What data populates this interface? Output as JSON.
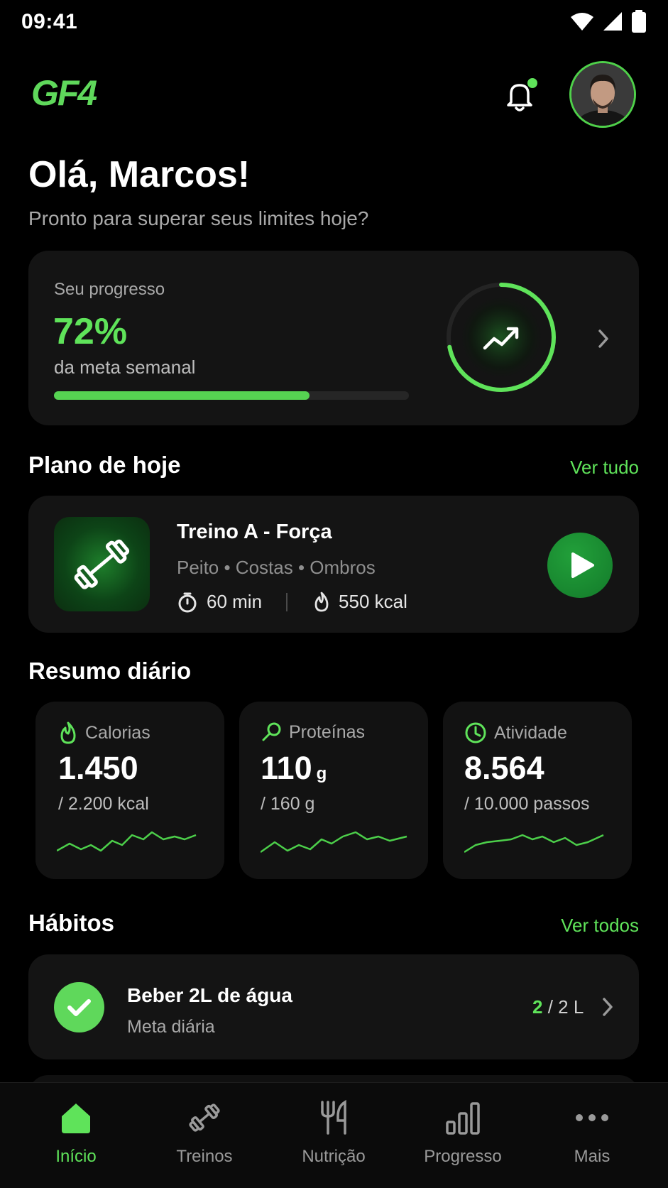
{
  "status_bar": {
    "time": "09:41"
  },
  "header": {
    "logo_text": "GF4"
  },
  "greeting": {
    "title": "Olá, Marcos!",
    "subtitle": "Pronto para superar seus limites hoje?"
  },
  "progress": {
    "label": "Seu progresso",
    "percent": "72%",
    "subtitle": "da meta semanal",
    "bar_fraction": 0.72
  },
  "plan": {
    "section_title": "Plano de hoje",
    "see_all": "Ver tudo",
    "workout_title": "Treino A - Força",
    "muscles": "Peito • Costas • Ombros",
    "duration": "60 min",
    "calories": "550 kcal"
  },
  "summary": {
    "section_title": "Resumo diário",
    "cards": [
      {
        "label": "Calorias",
        "value": "1.450",
        "unit": "",
        "goal": "/ 2.200 kcal",
        "icon": "flame-icon"
      },
      {
        "label": "Proteínas",
        "value": "110",
        "unit": "g",
        "goal": "/ 160 g",
        "icon": "drumstick-icon"
      },
      {
        "label": "Atividade",
        "value": "8.564",
        "unit": "",
        "goal": "/ 10.000 passos",
        "icon": "clock-icon"
      }
    ]
  },
  "habits": {
    "section_title": "Hábitos",
    "see_all": "Ver todos",
    "items": [
      {
        "title": "Beber 2L de água",
        "subtitle": "Meta diária",
        "current": "2",
        "target": "/ 2 L"
      }
    ]
  },
  "nav": {
    "items": [
      {
        "label": "Início",
        "icon": "home-icon",
        "active": true
      },
      {
        "label": "Treinos",
        "icon": "dumbbell-icon",
        "active": false
      },
      {
        "label": "Nutrição",
        "icon": "utensils-icon",
        "active": false
      },
      {
        "label": "Progresso",
        "icon": "bar-chart-icon",
        "active": false
      },
      {
        "label": "Mais",
        "icon": "more-icon",
        "active": false
      }
    ]
  },
  "colors": {
    "accent": "#5fe35a",
    "background": "#000000",
    "card": "#141414"
  }
}
